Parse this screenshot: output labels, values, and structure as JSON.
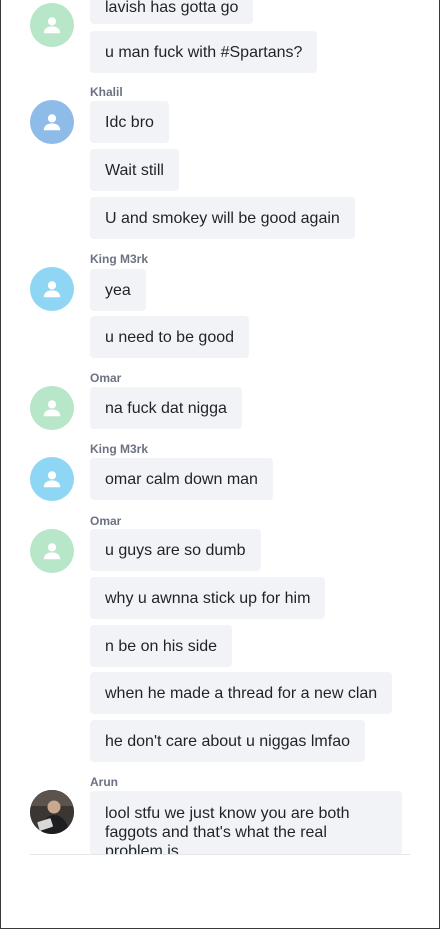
{
  "colors": {
    "avatar_green": "#b7e6c8",
    "avatar_blue": "#8fbbe8",
    "avatar_cyan": "#8fd6f4",
    "bubble_bg": "#f1f3f6",
    "name_text": "#6b7280"
  },
  "icons": {
    "default_avatar": "user-icon"
  },
  "chat": {
    "groups": [
      {
        "sender": "",
        "avatar_color": "avatar_green",
        "messages": [
          "lavish has gotta go",
          "u man fuck with #Spartans?"
        ]
      },
      {
        "sender": "Khalil",
        "avatar_color": "avatar_blue",
        "messages": [
          "Idc bro",
          "Wait still",
          "U and smokey will be good again"
        ]
      },
      {
        "sender": "King M3rk",
        "avatar_color": "avatar_cyan",
        "messages": [
          "yea",
          "u need to be good"
        ]
      },
      {
        "sender": "Omar",
        "avatar_color": "avatar_green",
        "messages": [
          "na fuck dat nigga"
        ]
      },
      {
        "sender": "King M3rk",
        "avatar_color": "avatar_cyan",
        "messages": [
          "omar calm down man"
        ]
      },
      {
        "sender": "Omar",
        "avatar_color": "avatar_green",
        "messages": [
          "u guys are so dumb",
          "why u awnna stick up for him",
          "n be on his side",
          "when he made a thread for a new clan",
          "he don't care about u niggas lmfao"
        ]
      },
      {
        "sender": "Arun",
        "avatar_color": "photo",
        "messages": [
          "lool stfu we just know you are both faggots and that's what the real problem is"
        ]
      }
    ]
  }
}
